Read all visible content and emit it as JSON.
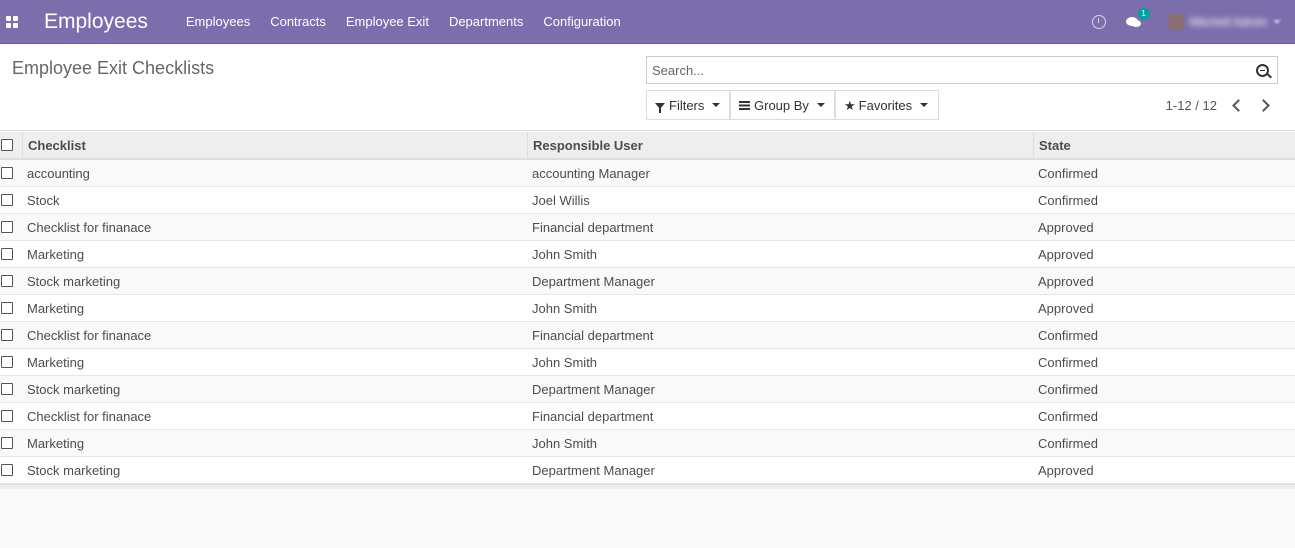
{
  "navbar": {
    "app_title": "Employees",
    "menu": [
      "Employees",
      "Contracts",
      "Employee Exit",
      "Departments",
      "Configuration"
    ],
    "message_count": "1",
    "user_name": "Mitchell Admin"
  },
  "control": {
    "page_title": "Employee Exit Checklists",
    "search_placeholder": "Search...",
    "filters_label": "Filters",
    "groupby_label": "Group By",
    "favorites_label": "Favorites",
    "pager": "1-12 / 12"
  },
  "table": {
    "columns": [
      "Checklist",
      "Responsible User",
      "State"
    ],
    "rows": [
      [
        "accounting",
        "accounting Manager",
        "Confirmed"
      ],
      [
        "Stock",
        "Joel Willis",
        "Confirmed"
      ],
      [
        "Checklist for finanace",
        "Financial department",
        "Approved"
      ],
      [
        "Marketing",
        "John Smith",
        "Approved"
      ],
      [
        "Stock marketing",
        "Department Manager",
        "Approved"
      ],
      [
        "Marketing",
        "John Smith",
        "Approved"
      ],
      [
        "Checklist for finanace",
        "Financial department",
        "Confirmed"
      ],
      [
        "Marketing",
        "John Smith",
        "Confirmed"
      ],
      [
        "Stock marketing",
        "Department Manager",
        "Confirmed"
      ],
      [
        "Checklist for finanace",
        "Financial department",
        "Confirmed"
      ],
      [
        "Marketing",
        "John Smith",
        "Confirmed"
      ],
      [
        "Stock marketing",
        "Department Manager",
        "Approved"
      ]
    ]
  },
  "colors": {
    "navbar": "#7c6ead",
    "badge": "#00a09d"
  }
}
